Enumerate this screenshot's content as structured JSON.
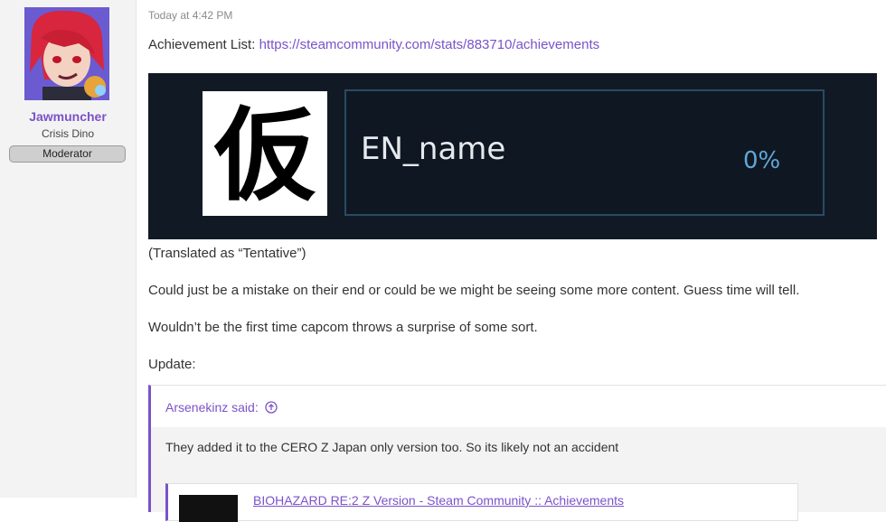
{
  "user": {
    "name": "Jawmuncher",
    "title": "Crisis Dino",
    "badge": "Moderator"
  },
  "post": {
    "timestamp": "Today at 4:42 PM",
    "achievement_list_label": "Achievement List: ",
    "achievement_list_url": "https://steamcommunity.com/stats/883710/achievements",
    "achievement": {
      "icon_char": "仮",
      "name": "EN_name",
      "percent": "0%"
    },
    "lines": [
      "(Translated as “Tentative”)",
      "Could just be a mistake on their end or could be we might be seeing some more content. Guess time will tell.",
      "Wouldn’t be the first time capcom throws a surprise of some sort.",
      "Update:"
    ],
    "quote": {
      "author": "Arsenekinz said:",
      "text": "They added it to the CERO Z Japan only version too. So its likely not an accident",
      "embed_title": "BIOHAZARD RE:2 Z Version - Steam Community :: Achievements"
    }
  },
  "colors": {
    "accent": "#7b52c9",
    "achievement_bg": "#111a24",
    "percent": "#5fa7d8"
  }
}
